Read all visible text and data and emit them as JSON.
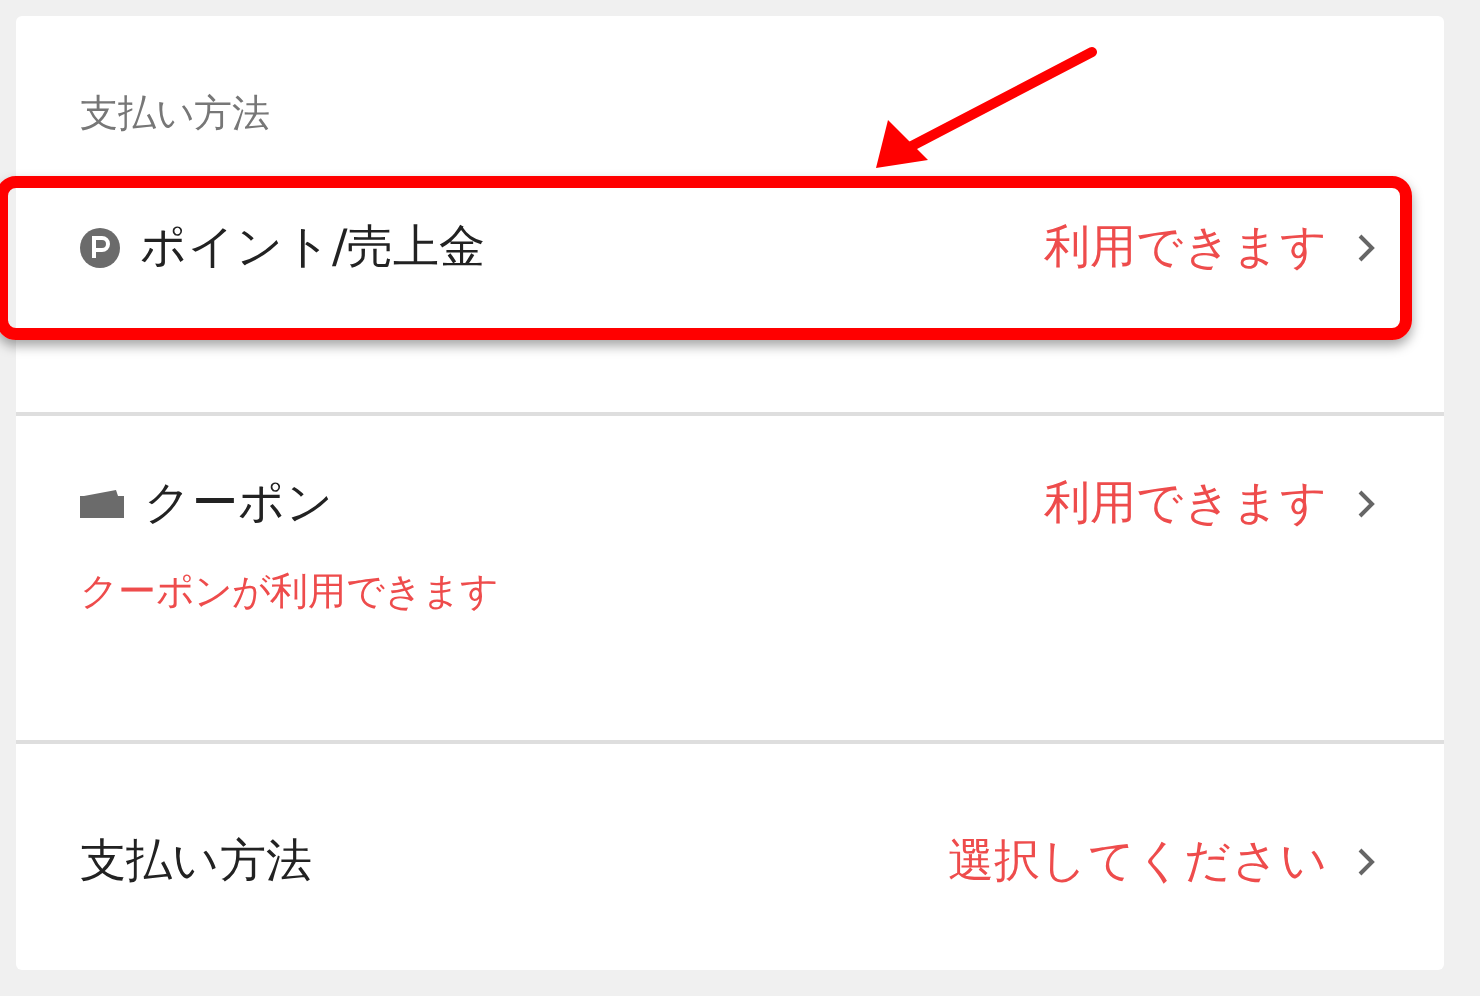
{
  "section_title": "支払い方法",
  "rows": [
    {
      "kind": "point",
      "label": "ポイント/売上金",
      "status": "利用できます",
      "highlighted": true
    },
    {
      "kind": "coupon",
      "label": "クーポン",
      "status": "利用できます",
      "note": "クーポンが利用できます"
    },
    {
      "kind": "plain",
      "label": "支払い方法",
      "status": "選択してください"
    }
  ]
}
